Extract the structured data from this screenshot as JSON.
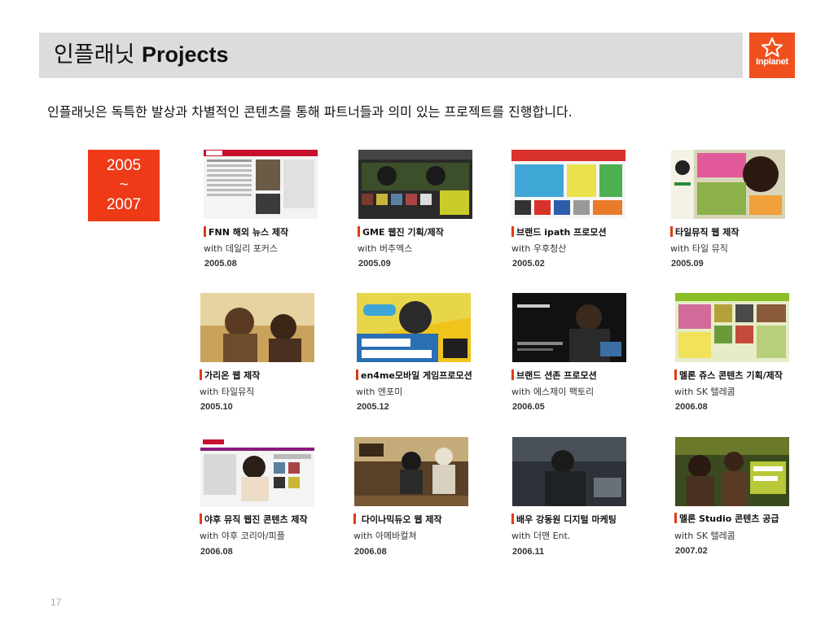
{
  "header": {
    "title_ko": "인플래닛",
    "title_en": "Projects",
    "logo_text": "Inplanet",
    "logo_icon": "star-icon"
  },
  "subtitle": "인플래닛은 독특한 발상과 차별적인 콘텐츠를 통해 파트너들과 의미 있는 프로젝트를 진행합니다.",
  "period": {
    "start": "2005",
    "sep": "~",
    "end": "2007"
  },
  "projects": [
    {
      "title": "FNN 해외 뉴스 제작",
      "with": "with 데일리 포커스",
      "date": "2005.08"
    },
    {
      "title": "GME 웹진 기획/제작",
      "with": "with 버추엑스",
      "date": "2005.09"
    },
    {
      "title": "브랜드 ipath 프로모션",
      "with": "with 우후청산",
      "date": "2005.02"
    },
    {
      "title": "타일뮤직 웹 제작",
      "with": "with 타일 뮤직",
      "date": "2005.09"
    },
    {
      "title": "가리온 웹 제작",
      "with": "with 타일뮤직",
      "date": "2005.10"
    },
    {
      "title": "en4me모바일 게임프로모션",
      "with": "with 엔포미",
      "date": "2005.12"
    },
    {
      "title": "브랜드 션존 프로모션",
      "with": "with 에스제이 팩토리",
      "date": "2006.05"
    },
    {
      "title": "멜론 쥬스 콘텐츠 기획/제작",
      "with": "with SK 텔레콤",
      "date": "2006.08"
    },
    {
      "title": "야후 뮤직 웹진 콘텐츠 제작",
      "with": "with 야후 코리아/피플",
      "date": "2006.08"
    },
    {
      "title": " 다이나믹듀오 웹 제작",
      "with": "with 아메바컬쳐",
      "date": "2006.08"
    },
    {
      "title": "배우 강동원 디지털 마케팅",
      "with": "with 더맨 Ent.",
      "date": "2006.11"
    },
    {
      "title": "멜론 Studio 콘텐츠 공급",
      "with": "with SK 텔레콤",
      "date": "2007.02"
    }
  ],
  "page_number": "17",
  "colors": {
    "accent": "#ee3a17",
    "title_bar": "#dcdcdc",
    "logo_bg": "#f0501e"
  }
}
